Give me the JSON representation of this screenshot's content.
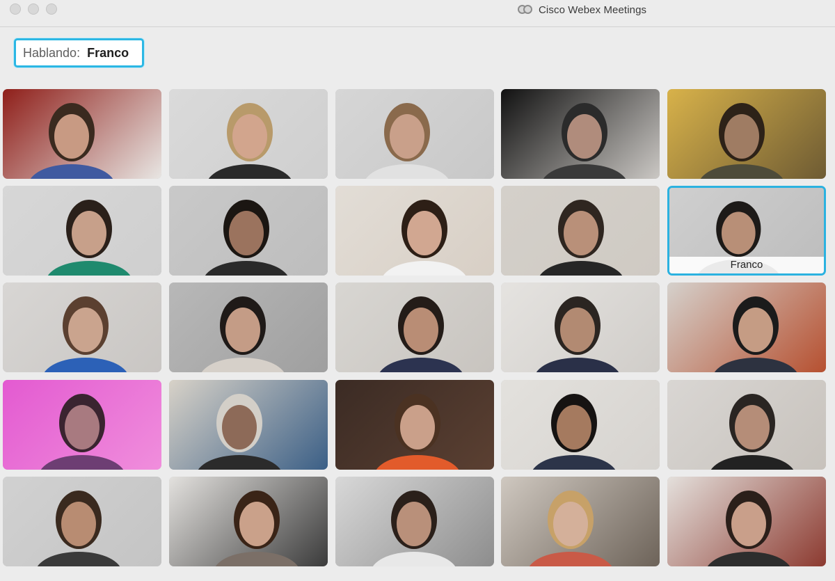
{
  "window": {
    "title": "Cisco Webex Meetings",
    "app_icon": "webex-logo-icon"
  },
  "speaking": {
    "label": "Hablando:",
    "name": "Franco"
  },
  "accent_color": "#2cb7e4",
  "participants": [
    {
      "name": "",
      "bg": "#8f1f1a",
      "wall": "#e8e6e3",
      "skin": "#c89a83",
      "hair": "#3a2a1f",
      "shirt": "#405aa0"
    },
    {
      "name": "",
      "bg": "#dadada",
      "wall": "#cfcfcf",
      "skin": "#d2a58d",
      "hair": "#b89a6a",
      "shirt": "#2a2a2a"
    },
    {
      "name": "",
      "bg": "#d6d6d6",
      "wall": "#c8c8c8",
      "skin": "#c9a08a",
      "hair": "#8a6a4c",
      "shirt": "#e1e1e1"
    },
    {
      "name": "",
      "bg": "#111111",
      "wall": "#cbc8c4",
      "skin": "#b08c7c",
      "hair": "#2b2b2b",
      "shirt": "#3a3a3a"
    },
    {
      "name": "",
      "bg": "#d8b24a",
      "wall": "#6e5b33",
      "skin": "#9f7c63",
      "hair": "#2d2218",
      "shirt": "#4d4b3a"
    },
    {
      "name": "",
      "bg": "#d7d7d7",
      "wall": "#cfcfcf",
      "skin": "#c7a08a",
      "hair": "#2a201a",
      "shirt": "#1f8a6e"
    },
    {
      "name": "",
      "bg": "#c9c9c9",
      "wall": "#bdbdbd",
      "skin": "#9b735e",
      "hair": "#1b1612",
      "shirt": "#2a2a2a"
    },
    {
      "name": "",
      "bg": "#e2ddd6",
      "wall": "#d8cfc5",
      "skin": "#d1a791",
      "hair": "#2d1f16",
      "shirt": "#f2f2f2"
    },
    {
      "name": "",
      "bg": "#d4d0ca",
      "wall": "#cfcac3",
      "skin": "#b99079",
      "hair": "#2f2620",
      "shirt": "#262626"
    },
    {
      "name": "Franco",
      "bg": "#cfcfcf",
      "wall": "#bdbdbd",
      "skin": "#b88f77",
      "hair": "#1d1a18",
      "shirt": "#2a2a2a"
    },
    {
      "name": "",
      "bg": "#d8d6d4",
      "wall": "#c9c6c3",
      "skin": "#caa48e",
      "hair": "#5b4030",
      "shirt": "#2c61b7"
    },
    {
      "name": "",
      "bg": "#b8b8b8",
      "wall": "#9f9f9f",
      "skin": "#c49c86",
      "hair": "#1f1a18",
      "shirt": "#d6d0c9"
    },
    {
      "name": "",
      "bg": "#d8d6d2",
      "wall": "#c8c4bf",
      "skin": "#b98d75",
      "hair": "#241c18",
      "shirt": "#2c3350"
    },
    {
      "name": "",
      "bg": "#e5e3e0",
      "wall": "#d0cdc9",
      "skin": "#b28a72",
      "hair": "#2b2521",
      "shirt": "#2a3048"
    },
    {
      "name": "",
      "bg": "#d5d1cc",
      "wall": "#b65030",
      "skin": "#c59c84",
      "hair": "#1b1b1b",
      "shirt": "#2d3240"
    },
    {
      "name": "",
      "bg": "#e35ad1",
      "wall": "#f08edc",
      "skin": "#a87a80",
      "hair": "#3a2430",
      "shirt": "#6d3e73"
    },
    {
      "name": "",
      "bg": "#d8d2c8",
      "wall": "#3b5f86",
      "skin": "#8d6a58",
      "hair": "#d3cfc8",
      "shirt": "#2b2b2b"
    },
    {
      "name": "",
      "bg": "#3b2b24",
      "wall": "#5b4032",
      "skin": "#caa08a",
      "hair": "#4b3222",
      "shirt": "#e25b2b"
    },
    {
      "name": "",
      "bg": "#e3e1dd",
      "wall": "#d6d3cf",
      "skin": "#a57a5f",
      "hair": "#161312",
      "shirt": "#2c3449"
    },
    {
      "name": "",
      "bg": "#d9d6d3",
      "wall": "#c7c2bc",
      "skin": "#b58d78",
      "hair": "#2a2522",
      "shirt": "#222222"
    },
    {
      "name": "",
      "bg": "#d1d1d1",
      "wall": "#c4c4c4",
      "skin": "#b88c72",
      "hair": "#3a2a1f",
      "shirt": "#3a3a3a"
    },
    {
      "name": "",
      "bg": "#e3e1de",
      "wall": "#3b3b3b",
      "skin": "#caa18a",
      "hair": "#3a2417",
      "shirt": "#7b6f67"
    },
    {
      "name": "",
      "bg": "#d8d8d8",
      "wall": "#8d8d8d",
      "skin": "#b9907a",
      "hair": "#2b201a",
      "shirt": "#e8e8e8"
    },
    {
      "name": "",
      "bg": "#cfc8c0",
      "wall": "#6d6359",
      "skin": "#d4b09a",
      "hair": "#c7a168",
      "shirt": "#c95a47"
    },
    {
      "name": "",
      "bg": "#e4e0dc",
      "wall": "#8c3a30",
      "skin": "#c99f8a",
      "hair": "#2b1f1a",
      "shirt": "#2d2d2d"
    }
  ]
}
